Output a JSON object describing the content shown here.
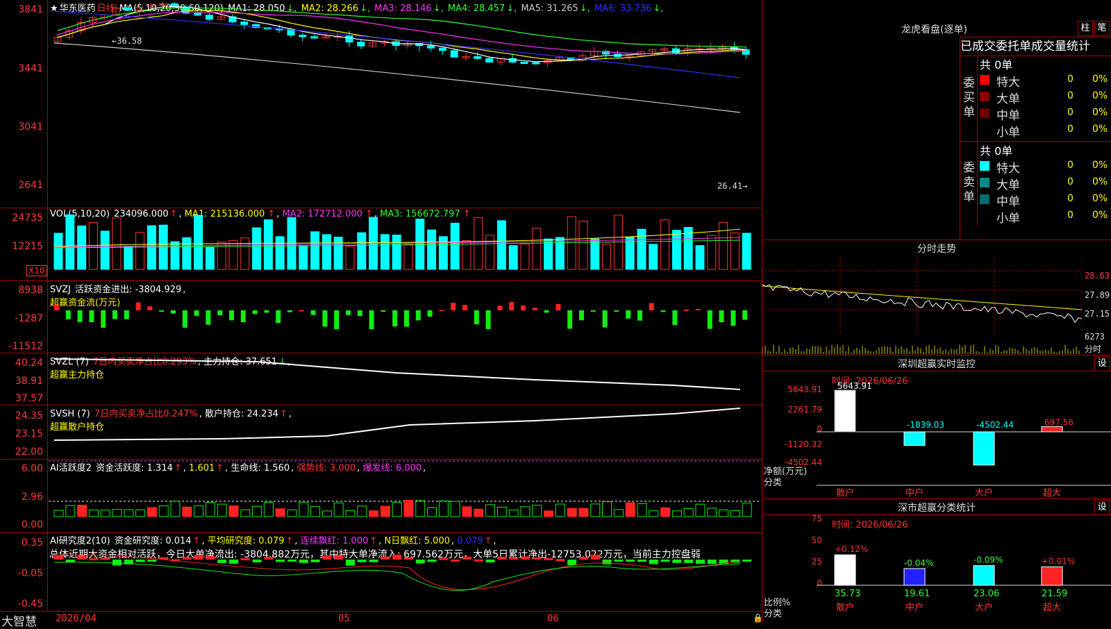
{
  "main": {
    "stock_name": "华东医药",
    "period": "日线",
    "ma_label": "MA(5,10,20,30,60,120)",
    "ma": [
      {
        "label": "MA1:",
        "value": "28.050",
        "arrow": "↓",
        "color": "#ffffff"
      },
      {
        "label": "MA2:",
        "value": "28.266",
        "arrow": "↓",
        "color": "#ffff00"
      },
      {
        "label": "MA3:",
        "value": "28.146",
        "arrow": "↓",
        "color": "#ff33ff"
      },
      {
        "label": "MA4:",
        "value": "28.457",
        "arrow": "↓",
        "color": "#33ff33"
      },
      {
        "label": "MA5:",
        "value": "31.265",
        "arrow": "↓",
        "color": "#cccccc"
      },
      {
        "label": "MA6:",
        "value": "33.736",
        "arrow": "↓",
        "color": "#3030ff"
      }
    ],
    "yticks": [
      "3841",
      "3441",
      "3041",
      "2641"
    ],
    "high_label": "36.58",
    "low_label": "26.41"
  },
  "vol": {
    "label": "VOL(5,10,20)",
    "value": "234096.000",
    "ma1": "215136.000",
    "ma2": "172712.000",
    "ma3": "156672.797",
    "yticks": [
      "24735",
      "12215"
    ],
    "unit": "X10"
  },
  "svzj": {
    "label": "SVZJ",
    "text1": "活跃资金进出: -3804.929",
    "text2": "超赢资金流(万元)",
    "yticks": [
      "8938",
      "-1287",
      "-11512"
    ]
  },
  "svzl": {
    "label": "SVZL (7)",
    "ratio": "7日内买卖净占比0.293%",
    "hold": "主力持仓: 37.651",
    "title": "超赢主力持仓",
    "yticks": [
      "40.24",
      "38.91",
      "37.57"
    ]
  },
  "svsh": {
    "label": "SVSH (7)",
    "ratio": "7日内买卖净占比0.247%",
    "hold": "散户持仓: 24.234",
    "title": "超赢散户持仓",
    "yticks": [
      "24.35",
      "23.15",
      "22.00"
    ]
  },
  "ai1": {
    "label": "AI活跃度2",
    "activity": "资金活跃度: 1.314",
    "v2": "1.601",
    "life": "生命线: 1.560",
    "strong": "强势线: 3.000",
    "burst": "爆发线: 6.000",
    "yticks": [
      "6.00",
      "2.96",
      "0.00"
    ]
  },
  "ai2": {
    "label": "AI研究度2(10)",
    "research": "资金研究度: 0.014",
    "avg": "平均研究度: 0.079",
    "streak": "连续飘红: 1.000",
    "ndays": "N日飘红: 5.000",
    "last": "0.079",
    "summary": "总体近期大资金相对活跃，今日大单净流出: -3804.882万元，其中特大单净流入: 697.562万元，大单5日累计净出-12753.022万元，当前主力控盘弱",
    "yticks": [
      "0.35",
      "-0.05",
      "-0.45"
    ]
  },
  "bottom": {
    "brand": "大智慧",
    "dates": [
      "2026/04",
      "05",
      "06"
    ]
  },
  "longhu": {
    "title": "龙虎看盘(逐单)",
    "btn1": "柱",
    "btn2": "笔",
    "tabs": "已成交委托单成交量统计",
    "buy_label": "委买单",
    "sell_label": "委卖单",
    "buy_total": "共 0单",
    "sell_total": "共 0单",
    "buy_rows": [
      {
        "name": "特大",
        "n": "0",
        "p": "0%",
        "color": "#ff0000"
      },
      {
        "name": "大单",
        "n": "0",
        "p": "0%",
        "color": "#8b0000"
      },
      {
        "name": "中单",
        "n": "0",
        "p": "0%",
        "color": "#6a0000"
      },
      {
        "name": "小单",
        "n": "0",
        "p": "0%",
        "color": "#000000"
      }
    ],
    "sell_rows": [
      {
        "name": "特大",
        "n": "0",
        "p": "0%",
        "color": "#00ffff"
      },
      {
        "name": "大单",
        "n": "0",
        "p": "0%",
        "color": "#008b8b"
      },
      {
        "name": "中单",
        "n": "0",
        "p": "0%",
        "color": "#006b6b"
      },
      {
        "name": "小单",
        "n": "0",
        "p": "0%",
        "color": "#000000"
      }
    ]
  },
  "fenshi": {
    "title": "分时走势",
    "yticks": [
      "28.63",
      "27.89",
      "27.15"
    ],
    "vol": "6273",
    "unit": "分时"
  },
  "monitor": {
    "title": "深圳超赢实时监控",
    "btn": "设",
    "time": "时间: 2026/06/26",
    "yticks": [
      "5643.91",
      "2261.79",
      "0",
      "-1120.32",
      "-4502.44"
    ],
    "ylabel": "净额(万元)",
    "xlabel": "分类",
    "cats": [
      "散户",
      "中户",
      "大户",
      "超大"
    ],
    "values": [
      "5643.91",
      "-1839.03",
      "-4502.44",
      "697.56"
    ]
  },
  "stats": {
    "title": "深市超赢分类统计",
    "btn": "设",
    "time": "时间: 2026/06/26",
    "yticks": [
      "75",
      "50",
      "25",
      "0"
    ],
    "ylabel": "比例%",
    "xlabel": "分类",
    "cats": [
      "散户",
      "中户",
      "大户",
      "超大"
    ],
    "values": [
      "35.73",
      "19.61",
      "23.06",
      "21.59"
    ],
    "changes": [
      "+0.12%",
      "-0.04%",
      "-0.09%",
      "+0.01%"
    ]
  }
}
